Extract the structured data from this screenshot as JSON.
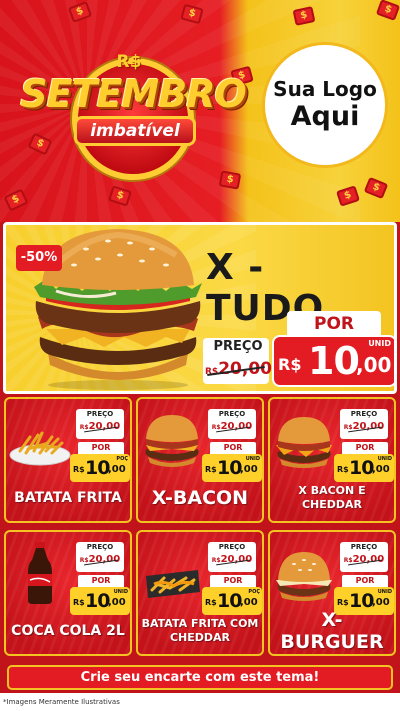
{
  "header": {
    "currency_symbol": "R$",
    "headline": "SETEMBRO",
    "tagline": "imbatível",
    "logo_line1": "Sua Logo",
    "logo_line2": "Aqui"
  },
  "featured": {
    "discount": "-50%",
    "title": "X - TUDO",
    "preco_label": "PREÇO",
    "old_currency": "R$",
    "old_price": "20,00",
    "por_label": "POR",
    "currency": "R$",
    "price_int": "10",
    "price_cents": ",00",
    "unit": "UNID"
  },
  "products": [
    {
      "name": "BATATA FRITA",
      "preco_label": "PREÇO",
      "old_currency": "R$",
      "old_price": "20,00",
      "por_label": "POR",
      "currency": "R$",
      "price_int": "10",
      "price_cents": ",00",
      "unit": "POÇ"
    },
    {
      "name": "X-BACON",
      "preco_label": "PREÇO",
      "old_currency": "R$",
      "old_price": "20,00",
      "por_label": "POR",
      "currency": "R$",
      "price_int": "10",
      "price_cents": ",00",
      "unit": "UNID"
    },
    {
      "name": "X BACON E CHEDDAR",
      "preco_label": "PREÇO",
      "old_currency": "R$",
      "old_price": "20,00",
      "por_label": "POR",
      "currency": "R$",
      "price_int": "10",
      "price_cents": ",00",
      "unit": "UNID"
    },
    {
      "name": "COCA COLA 2L",
      "preco_label": "PREÇO",
      "old_currency": "R$",
      "old_price": "20,00",
      "por_label": "POR",
      "currency": "R$",
      "price_int": "10",
      "price_cents": ",00",
      "unit": "UNID"
    },
    {
      "name": "BATATA FRITA COM CHEDDAR",
      "preco_label": "PREÇO",
      "old_currency": "R$",
      "old_price": "20,00",
      "por_label": "POR",
      "currency": "R$",
      "price_int": "10",
      "price_cents": ",00",
      "unit": "POÇ"
    },
    {
      "name": "X-BURGUER",
      "preco_label": "PREÇO",
      "old_currency": "R$",
      "old_price": "20,00",
      "por_label": "POR",
      "currency": "R$",
      "price_int": "10",
      "price_cents": ",00",
      "unit": "UNID"
    }
  ],
  "footer": {
    "cta": "Crie seu encarte com este tema!",
    "disclaimer": "*Imagens Meramente Ilustrativas"
  },
  "colors": {
    "brand_red": "#e31c23",
    "brand_yellow": "#f3c421",
    "price_yellow": "#ffd02a"
  }
}
